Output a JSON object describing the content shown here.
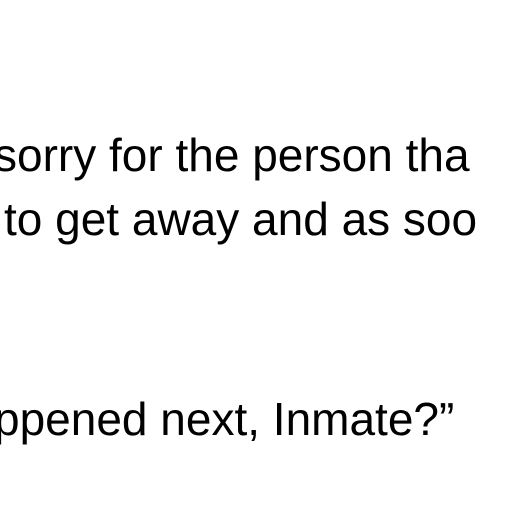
{
  "document": {
    "lines": [
      "sorry for the person tha",
      "to get away and as soo",
      "ppened next, Inmate?”"
    ]
  }
}
